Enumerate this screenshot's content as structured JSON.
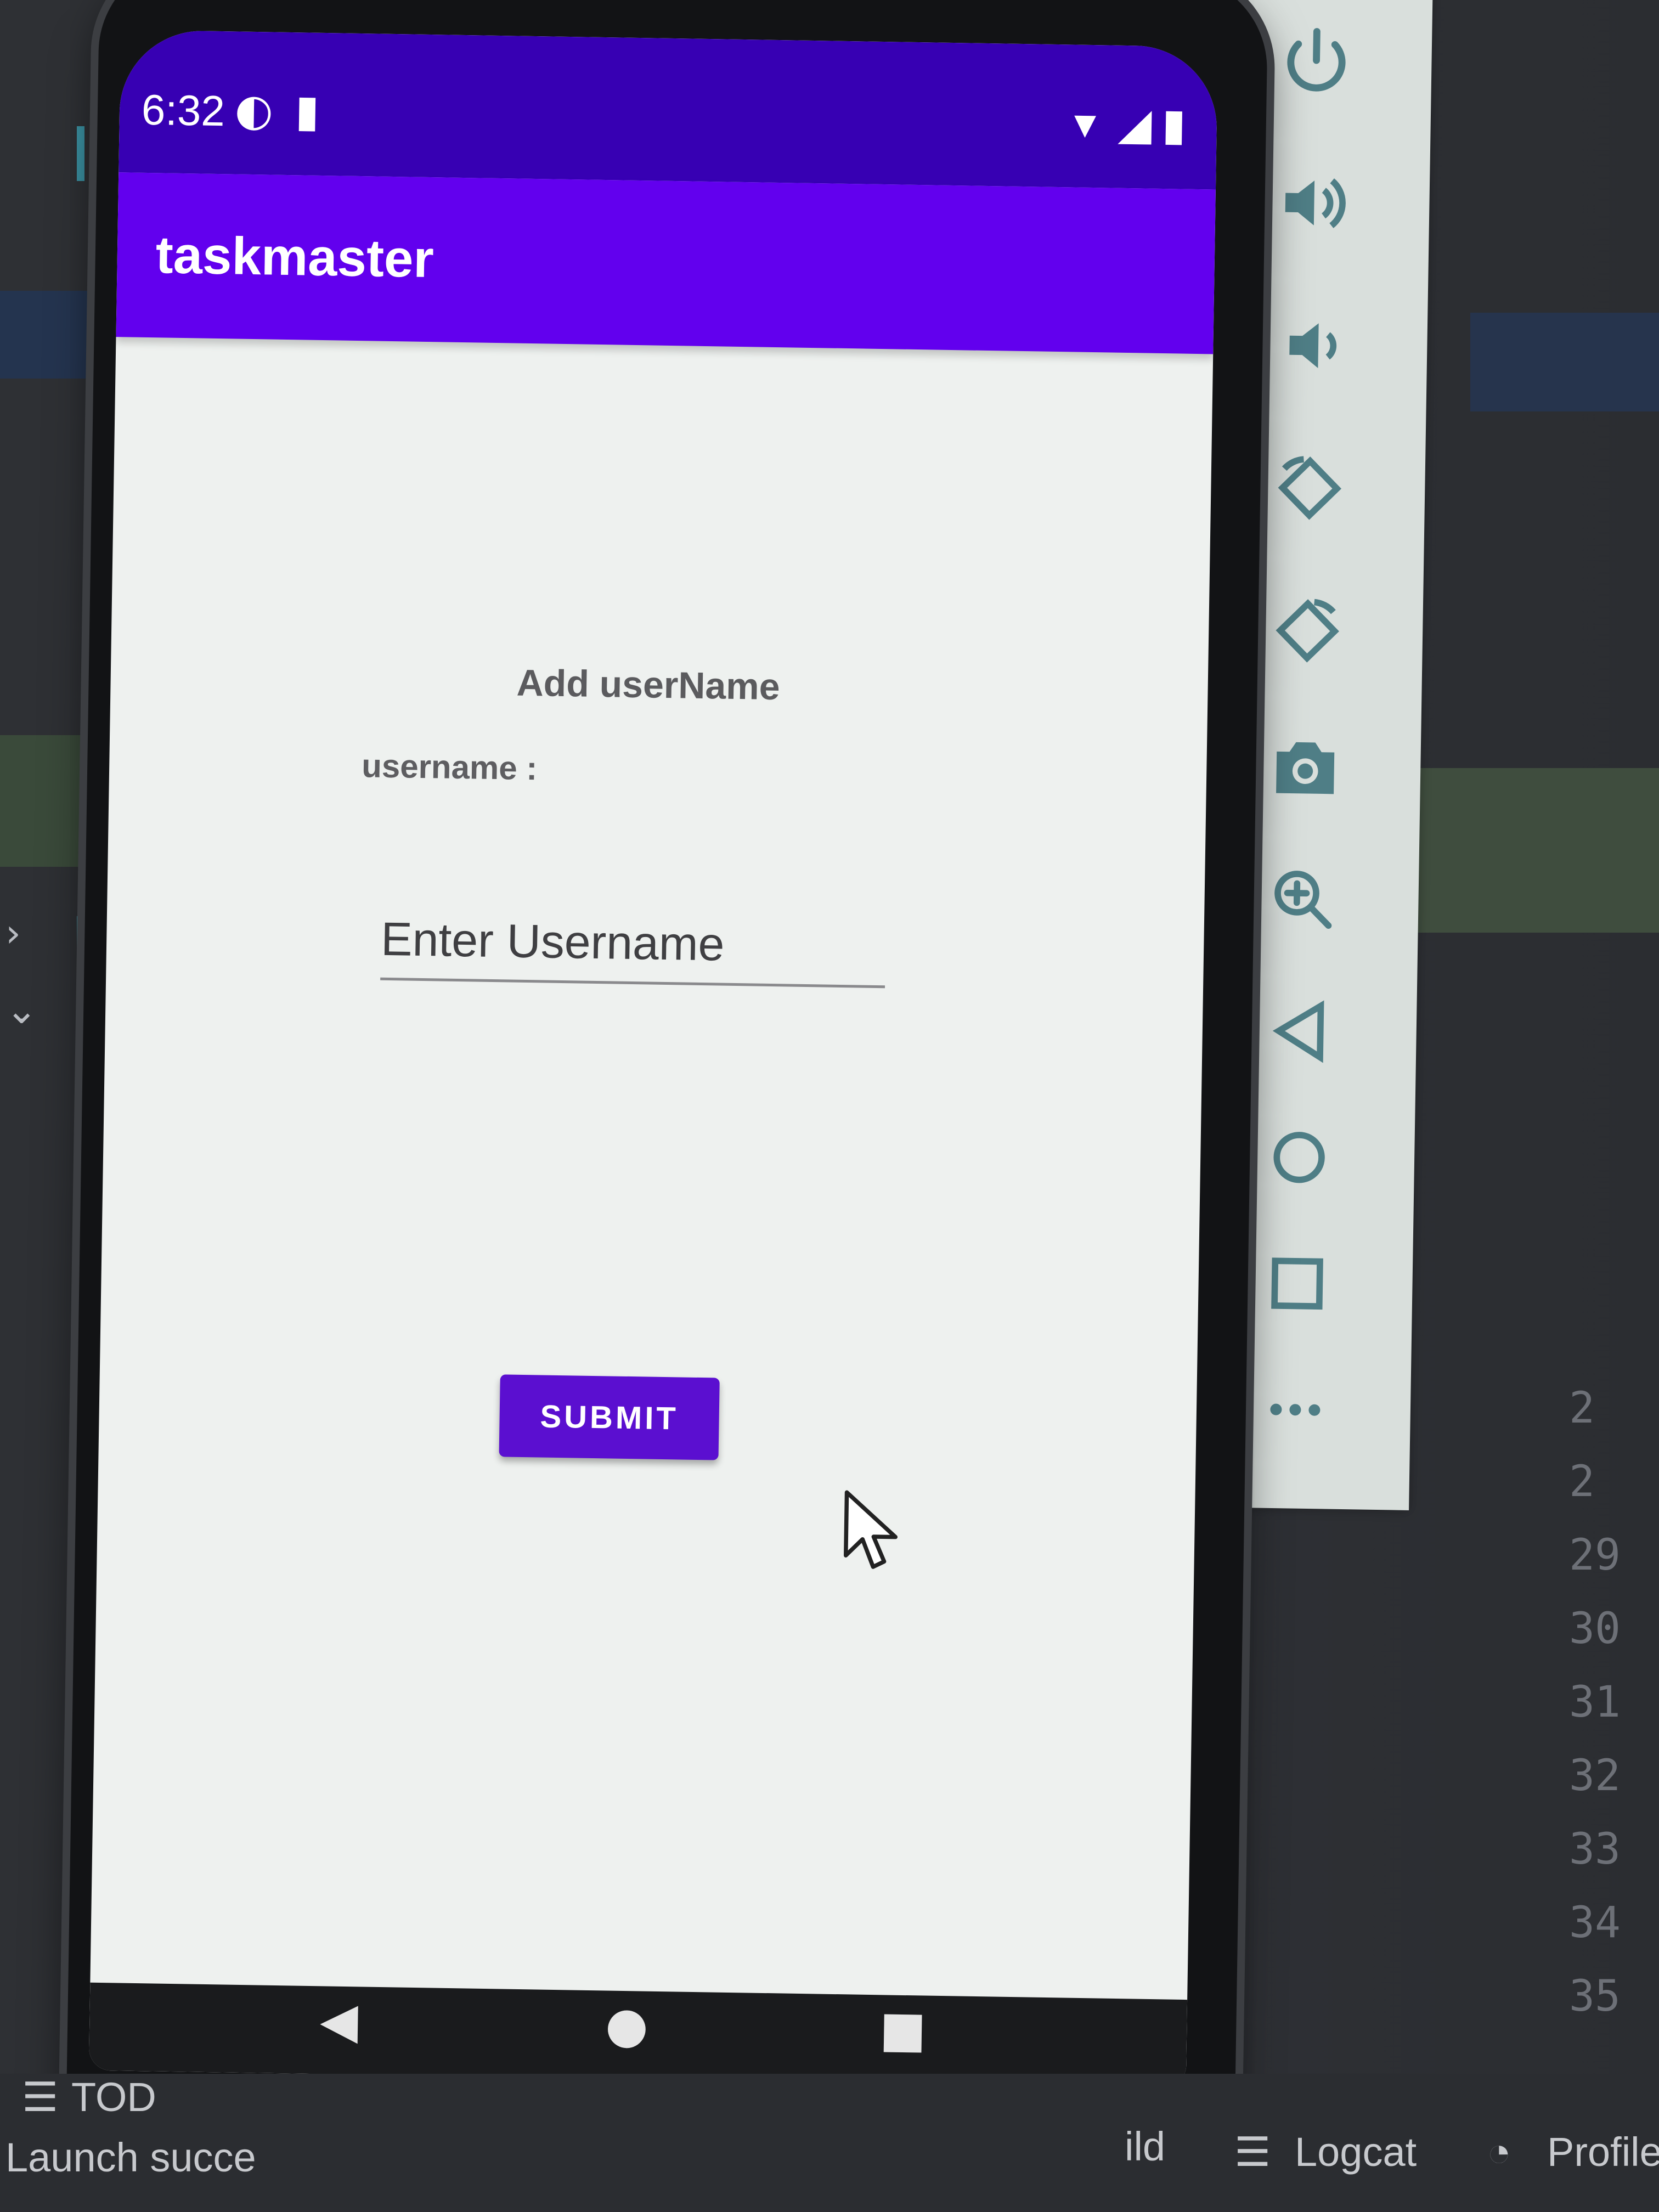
{
  "status_bar": {
    "time": "6:32"
  },
  "app_bar": {
    "title": "taskmaster"
  },
  "form": {
    "heading": "Add userName",
    "label": "username :",
    "input_placeholder": "Enter Username",
    "input_value": "",
    "submit_label": "SUBMIT"
  },
  "colors": {
    "status_bar": "#3700b3",
    "app_bar": "#6200ee",
    "button": "#5b0fd0",
    "screen_bg": "#eef1ef"
  },
  "emulator_toolbar": {
    "icons": [
      "power-icon",
      "volume-up-icon",
      "volume-down-icon",
      "rotate-left-icon",
      "rotate-right-icon",
      "camera-icon",
      "zoom-icon",
      "back-icon",
      "home-icon",
      "overview-icon",
      "more-icon"
    ]
  },
  "ide": {
    "line_numbers": [
      "2",
      "2",
      "29",
      "30",
      "31",
      "32",
      "33",
      "34",
      "35"
    ],
    "todo_tab": "TOD",
    "logcat_tab": "Logcat",
    "profiler_tab": "Profile",
    "build_tab": "ild",
    "status_message": "Launch succe"
  }
}
